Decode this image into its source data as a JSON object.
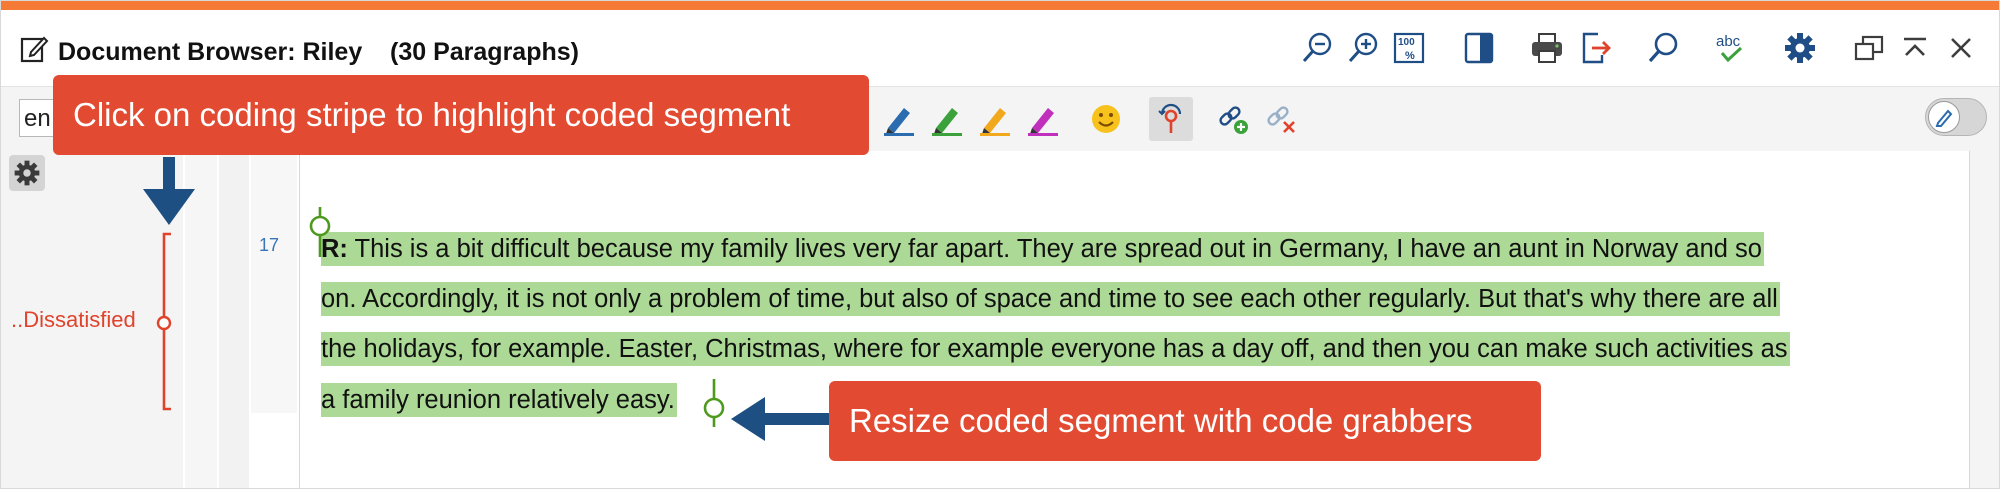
{
  "window": {
    "title": "Document Browser: Riley    (30 Paragraphs)"
  },
  "titlebar_icons": [
    "zoom-out-icon",
    "zoom-in-icon",
    "zoom-100-icon",
    "sidebar-panel-icon",
    "print-icon",
    "export-icon",
    "search-icon",
    "spellcheck-icon",
    "settings-gear-icon",
    "undock-window-icon",
    "collapse-icon",
    "close-icon"
  ],
  "toolbar": {
    "search_value": "en",
    "highlight_colors": [
      "#2b6cb0",
      "#3ba13b",
      "#f2a81d",
      "#c12fbd"
    ],
    "toggle_state": "off"
  },
  "document": {
    "paragraph_number": "17",
    "lines": [
      {
        "speaker": "R:",
        "text": " This is a bit difficult because my family lives very far apart. They are spread out in Germany, I have an aunt in Norway and so"
      },
      {
        "speaker": "",
        "text": "on. Accordingly, it is not only a problem of time, but also of space and time to see each other regularly. But that's why there are all"
      },
      {
        "speaker": "",
        "text": "the holidays, for example. Easter, Christmas, where for example everyone has a day off, and then you can make such activities as"
      },
      {
        "speaker": "",
        "text": "a family reunion relatively easy."
      }
    ],
    "highlight_color": "#acd996"
  },
  "coding_stripe": {
    "label": "..Dissatisfied",
    "color": "#e0432c"
  },
  "callouts": {
    "top": "Click on coding stripe to highlight coded segment",
    "bottom": "Resize coded segment with code grabbers",
    "color": "#e24b31",
    "arrow_color": "#1d4f82"
  },
  "colors": {
    "window_accent": "#f47a36",
    "grabber": "#4e9a1f"
  }
}
